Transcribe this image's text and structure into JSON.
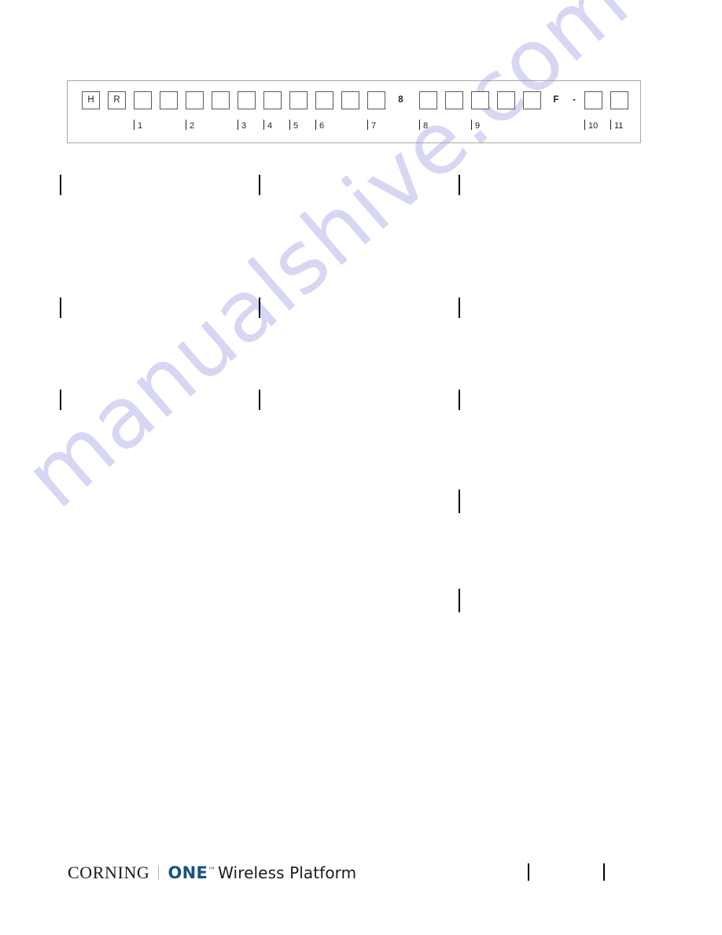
{
  "document": {
    "page_background": "#ffffff",
    "text_color": "#231f20"
  },
  "watermark": {
    "text": "manualshive.com",
    "color": "#d7d7f4"
  },
  "part_number_diagram": {
    "border_color": "#a8a8a8",
    "cell_border_color": "#58595b",
    "prefix_cells": [
      {
        "value": "H"
      },
      {
        "value": "R"
      }
    ],
    "blank_cells_group_1_count": 10,
    "fixed_digit": "8",
    "blank_cells_group_2_count": 5,
    "suffix_letter": "F",
    "suffix_dash": "-",
    "blank_cells_group_3_count": 2,
    "callouts": [
      {
        "label": "1"
      },
      {
        "label": "2"
      },
      {
        "label": "3"
      },
      {
        "label": "4"
      },
      {
        "label": "5"
      },
      {
        "label": "6"
      },
      {
        "label": "7"
      },
      {
        "label": "8"
      },
      {
        "label": "9"
      },
      {
        "label": "10"
      },
      {
        "label": "11"
      }
    ]
  },
  "body_marks": {
    "description": "Paragraph indicator tick marks",
    "color": "#000000"
  },
  "footer": {
    "brand_corning": "CORNING",
    "brand_one": "ONE",
    "brand_tm": "™",
    "brand_product": "Wireless Platform",
    "brand_one_color": "#15527f",
    "brand_text_color": "#1a1a1a"
  }
}
